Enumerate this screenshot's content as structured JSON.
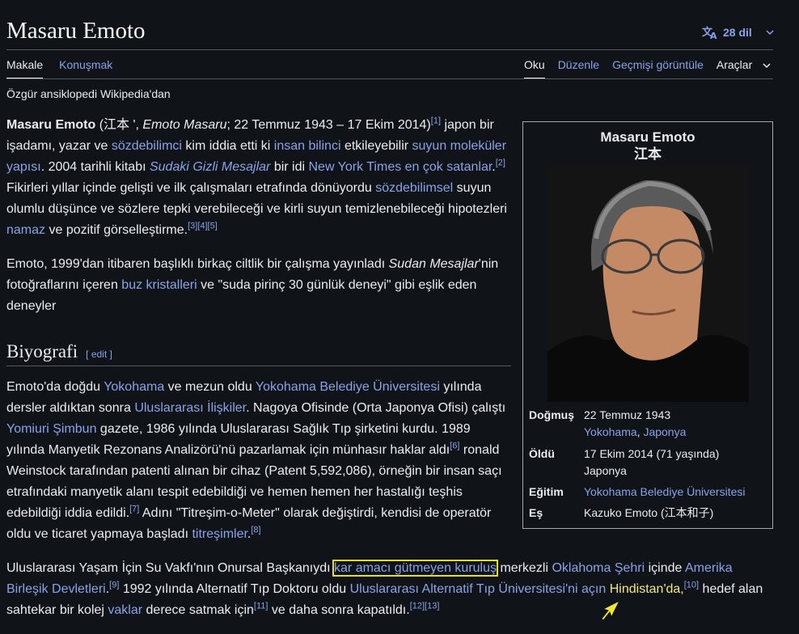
{
  "page": {
    "title": "Masaru Emoto",
    "languages": "28 dil",
    "tabs_left": [
      "Makale",
      "Konuşmak"
    ],
    "tabs_right": [
      "Oku",
      "Düzenle",
      "Geçmişi görüntüle",
      "Araçlar"
    ],
    "tagline": "Özgür ansiklopedi Wikipedia'dan"
  },
  "colors": {
    "background": "#101418",
    "link": "#88a3e8",
    "highlight": "#e8e01c"
  },
  "p1": {
    "name": "Masaru Emoto",
    "t1": " (江本 ', ",
    "it1": "Emoto Masaru",
    "t2": "; 22 Temmuz 1943 – 17 Ekim 2014)",
    "r1": "[1]",
    "t3": " japon bir işadamı, yazar ve ",
    "l1": "sözdebilimci",
    "t4": " kim iddia etti ki ",
    "l2": "insan bilinci",
    "t5": " etkileyebilir ",
    "l3": "suyun moleküler yapısı",
    "t6": ". 2004 tarihli kitabı ",
    "l4": "Sudaki Gizli Mesajlar",
    "t7": " bir idi ",
    "l5": "New York Times en çok satanlar",
    "t8": ".",
    "r2": "[2]",
    "t9": " Fikirleri yıllar içinde gelişti ve ilk çalışmaları etrafında dönüyordu ",
    "l6": "sözdebilimsel",
    "t10": " suyun olumlu düşünce ve sözlere tepki verebileceği ve kirli suyun temizlenebileceği hipotezleri ",
    "l7": "namaz",
    "t11": " ve pozitif görselleştirme.",
    "r3": "[3][4][5]"
  },
  "p2": {
    "t1": "Emoto, 1999'dan itibaren başlıklı birkaç ciltlik bir çalışma yayınladı ",
    "it1": "Sudan Mesajlar",
    "t2": "'nin fotoğraflarını içeren ",
    "l1": "buz kristalleri",
    "t3": " ve \"suda pirinç 30 günlük deneyi\" gibi eşlik eden deneyler"
  },
  "section": {
    "heading": "Biyografi",
    "edit": "[ edit ]"
  },
  "p3": {
    "t1": "Emoto'da doğdu ",
    "l1": "Yokohama",
    "t2": " ve mezun oldu ",
    "l2": "Yokohama Belediye Üniversitesi",
    "t3": " yılında dersler aldıktan sonra ",
    "l3": "Uluslararası İlişkiler",
    "t4": ". Nagoya Ofisinde (Orta Japonya Ofisi) çalıştı ",
    "l4": "Yomiuri Şimbun",
    "t5": " gazete, 1986 yılında Uluslararası Sağlık Tıp şirketini kurdu. 1989 yılında Manyetik Rezonans Analizörü'nü pazarlamak için münhasır haklar aldı",
    "r1": "[6]",
    "t6": " ronald Weinstock tarafından patenti alınan bir cihaz (Patent 5,592,086), örneğin bir insan saçı etrafındaki manyetik alanı tespit edebildiği ve hemen hemen her hastalığı teşhis edebildiği iddia edildi.",
    "r2": "[7]",
    "t7": " Adını \"Titreşim-o-Meter\" olarak değiştirdi, kendisi de operatör oldu ve ticaret yapmaya başladı ",
    "l5": "titreşimler",
    "t8": ".",
    "r3": "[8]"
  },
  "p4": {
    "t1": "Uluslararası Yaşam İçin Su Vakfı'nın Onursal Başkanıydı ",
    "l1": "kar amacı gütmeyen kuruluş",
    "t2": " merkezli ",
    "l2": "Oklahoma Şehri",
    "t3": " içinde ",
    "l3": "Amerika Birleşik Devletleri",
    "t4": ".",
    "r1": "[9]",
    "t5": " 1992 yılında Alternatif Tıp Doktoru oldu ",
    "l4": "Uluslararası Alternatif Tıp Üniversitesi'ni açın",
    "t6": " ",
    "l5": "Hindistan'da,",
    "r2": "[10]",
    "t7": " hedef alan sahtekar bir kolej ",
    "l6": "vaklar",
    "t8": " derece satmak için",
    "r3": "[11]",
    "t9": " ve daha sonra kapatıldı.",
    "r4": "[12][13]"
  },
  "infobox": {
    "name": "Masaru Emoto",
    "name_jp": "江本",
    "born_label": "Doğmuş",
    "born_date": "22 Temmuz 1943",
    "born_place1": "Yokohama",
    "born_sep": ", ",
    "born_place2": "Japonya",
    "died_label": "Öldü",
    "died_date": "17 Ekim 2014 (71 yaşında)",
    "died_place": "Japonya",
    "edu_label": "Eğitim",
    "edu_value": "Yokohama Belediye Üniversitesi",
    "spouse_label": "Eş",
    "spouse_value": "Kazuko Emoto (江本和子)"
  }
}
